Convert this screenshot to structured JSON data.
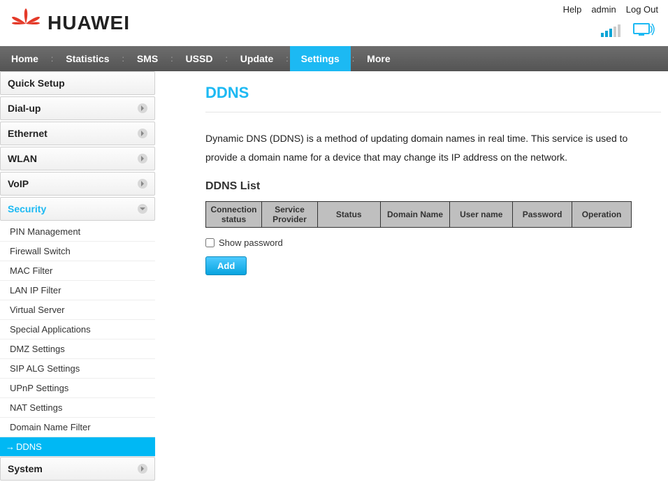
{
  "brand": {
    "name": "HUAWEI"
  },
  "top_links": {
    "help": "Help",
    "admin": "admin",
    "logout": "Log Out"
  },
  "nav": {
    "home": "Home",
    "statistics": "Statistics",
    "sms": "SMS",
    "ussd": "USSD",
    "update": "Update",
    "settings": "Settings",
    "more": "More"
  },
  "sidebar": {
    "quick_setup": "Quick Setup",
    "dial_up": "Dial-up",
    "ethernet": "Ethernet",
    "wlan": "WLAN",
    "voip": "VoIP",
    "security": "Security",
    "system": "System",
    "security_items": {
      "pin": "PIN Management",
      "firewall": "Firewall Switch",
      "mac": "MAC Filter",
      "lanip": "LAN IP Filter",
      "vserver": "Virtual Server",
      "special": "Special Applications",
      "dmz": "DMZ Settings",
      "sip": "SIP ALG Settings",
      "upnp": "UPnP Settings",
      "nat": "NAT Settings",
      "domain": "Domain Name Filter",
      "ddns": "DDNS"
    }
  },
  "content": {
    "title": "DDNS",
    "desc": "Dynamic DNS (DDNS) is a method of updating domain names in real time. This service is used to provide a domain name for a device that may change its IP address on the network.",
    "list_head": "DDNS List",
    "columns": {
      "conn": "Connection status",
      "provider": "Service Provider",
      "status": "Status",
      "domain": "Domain Name",
      "user": "User name",
      "pw": "Password",
      "op": "Operation"
    },
    "show_pw": "Show password",
    "add": "Add"
  }
}
